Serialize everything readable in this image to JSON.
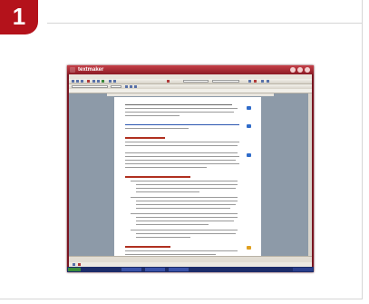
{
  "step_badge": {
    "number": "1"
  },
  "screenshot": {
    "window_title": "textmaker",
    "colors": {
      "badge": "#b4121b",
      "window_frame": "#7a1420",
      "titlebar": "#c64048",
      "workspace": "#8d9aa8",
      "taskbar": "#1d2d6a"
    },
    "icons": [
      "window-logo-icon",
      "minimize-icon",
      "maximize-icon",
      "close-icon",
      "start-button-icon"
    ]
  }
}
